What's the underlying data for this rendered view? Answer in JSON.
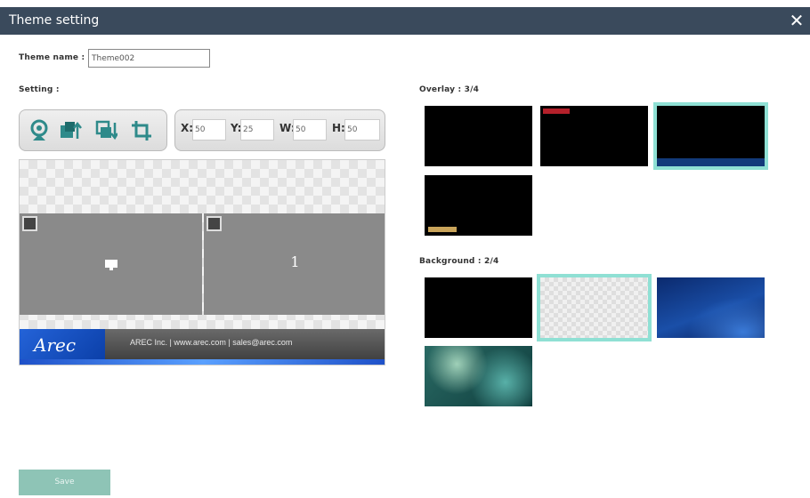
{
  "dialog": {
    "title": "Theme setting",
    "close_glyph": "✕"
  },
  "theme_name": {
    "label": "Theme name :",
    "value": "Theme002"
  },
  "setting": {
    "label": "Setting :",
    "tools": [
      "webcam-icon",
      "bring-to-front-icon",
      "send-to-back-icon",
      "crop-icon"
    ],
    "x": {
      "label": "X:",
      "value": "50"
    },
    "y": {
      "label": "Y:",
      "value": "25"
    },
    "w": {
      "label": "W:",
      "value": "50"
    },
    "h": {
      "label": "H:",
      "value": "50"
    }
  },
  "preview": {
    "pane2_number": "1",
    "banner_logo": "Arec",
    "banner_text": "AREC Inc.  |   www.arec.com  |  sales@arec.com"
  },
  "overlay": {
    "label": "Overlay : 3/4",
    "selected_index": 2
  },
  "background": {
    "label": "Background : 2/4",
    "selected_index": 1
  },
  "save_label": "Save",
  "colors": {
    "titlebar": "#3a4a5c",
    "accent": "#8fe0d4",
    "save_button": "#8ec4b6",
    "tool_icon": "#2e8a8a"
  }
}
